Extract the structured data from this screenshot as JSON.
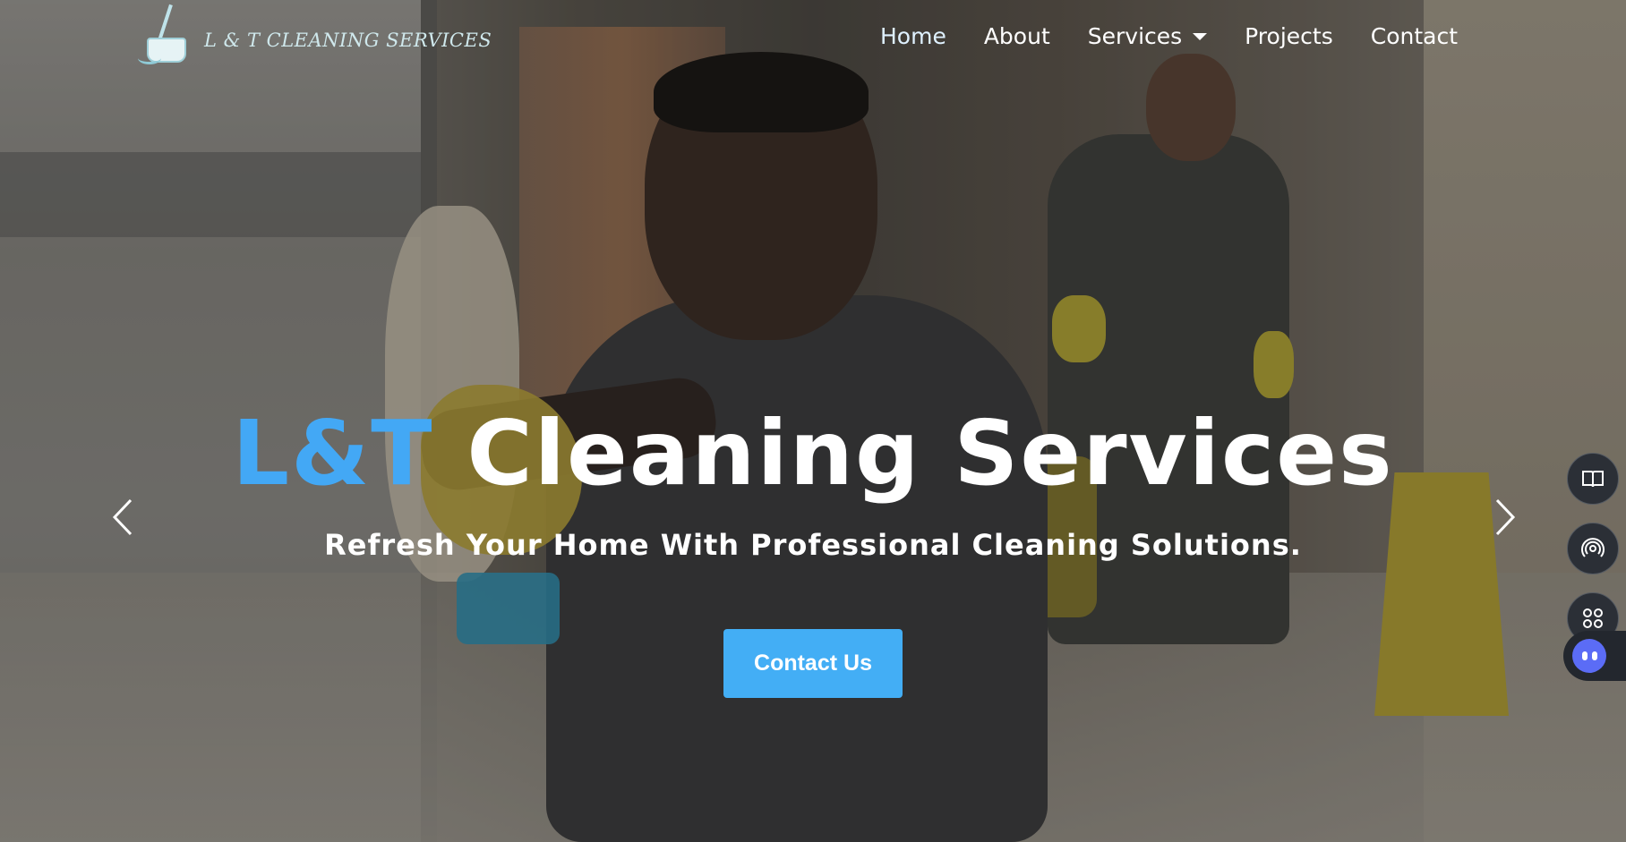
{
  "brand": {
    "logo_text": "L & T CLEANING SERVICES"
  },
  "nav": {
    "items": [
      {
        "label": "Home"
      },
      {
        "label": "About"
      },
      {
        "label": "Services"
      },
      {
        "label": "Projects"
      },
      {
        "label": "Contact"
      }
    ]
  },
  "hero": {
    "title_brand": "L&T",
    "title_rest": " Cleaning Services",
    "subtitle": "Refresh Your Home With Professional Cleaning Solutions.",
    "cta_label": "Contact Us"
  },
  "carousel": {
    "prev_icon": "chevron-left-icon",
    "next_icon": "chevron-right-icon"
  },
  "dock": {
    "icons": [
      "book-icon",
      "broadcast-icon",
      "grid-icon",
      "assistant-icon"
    ]
  },
  "colors": {
    "accent": "#43a8f5",
    "button": "#43aef5",
    "text": "#ffffff"
  }
}
